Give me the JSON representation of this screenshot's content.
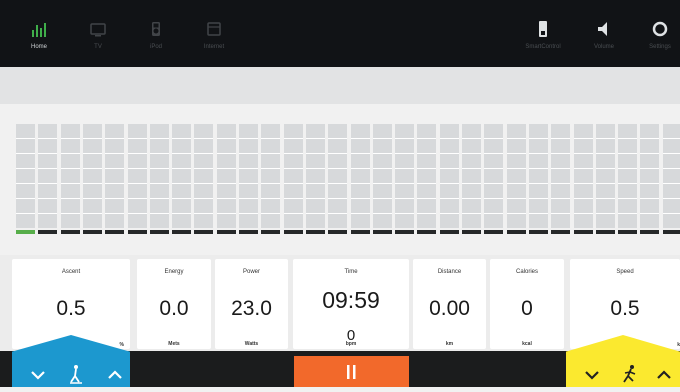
{
  "nav": {
    "left": [
      {
        "id": "home",
        "label": "Home",
        "active": true
      },
      {
        "id": "tv",
        "label": "TV",
        "active": false
      },
      {
        "id": "ipod",
        "label": "iPod",
        "active": false
      },
      {
        "id": "internet",
        "label": "Internet",
        "active": false
      }
    ],
    "right": [
      {
        "id": "smartcontrol",
        "label": "SmartControl"
      },
      {
        "id": "volume",
        "label": "Volume"
      },
      {
        "id": "settings",
        "label": "Settings"
      }
    ]
  },
  "profile": {
    "bar_count": 30,
    "current_index": 0
  },
  "metrics": {
    "ascent": {
      "label": "Ascent",
      "value": "0.5",
      "unit": "%"
    },
    "energy": {
      "label": "Energy",
      "value": "0.0",
      "unit": "Mets"
    },
    "power": {
      "label": "Power",
      "value": "23.0",
      "unit": "Watts"
    },
    "time": {
      "label": "Time",
      "value": "09:59",
      "sub_value": "0",
      "unit": "bpm"
    },
    "distance": {
      "label": "Distance",
      "value": "0.00",
      "unit": "km"
    },
    "calories": {
      "label": "Calories",
      "value": "0",
      "unit": "kcal"
    },
    "speed": {
      "label": "Speed",
      "value": "0.5",
      "unit": "k"
    }
  },
  "controls": {
    "ascent_color": "#1c98cf",
    "speed_color": "#fbe92f",
    "pause_color": "#f2692b"
  }
}
